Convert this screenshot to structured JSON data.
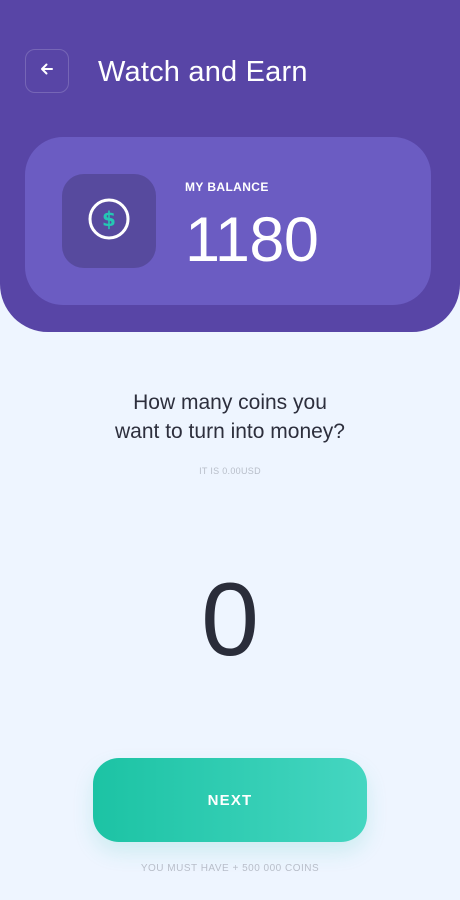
{
  "header": {
    "title": "Watch and Earn",
    "back_icon": "arrow-left-icon"
  },
  "balance": {
    "label": "MY BALANCE",
    "value": "1180",
    "icon": "dollar-coin-icon"
  },
  "prompt": {
    "question_line1": "How many coins you",
    "question_line2": "want to turn into money?",
    "usd_note": "IT IS 0.00USD"
  },
  "amount": {
    "value": "0"
  },
  "actions": {
    "next_label": "NEXT",
    "footnote": "YOU MUST HAVE + 500 000 COINS"
  },
  "colors": {
    "header": "#5845a6",
    "card": "#6b5cc2",
    "accent": "#1cc3a4",
    "background": "#eef5ff"
  }
}
